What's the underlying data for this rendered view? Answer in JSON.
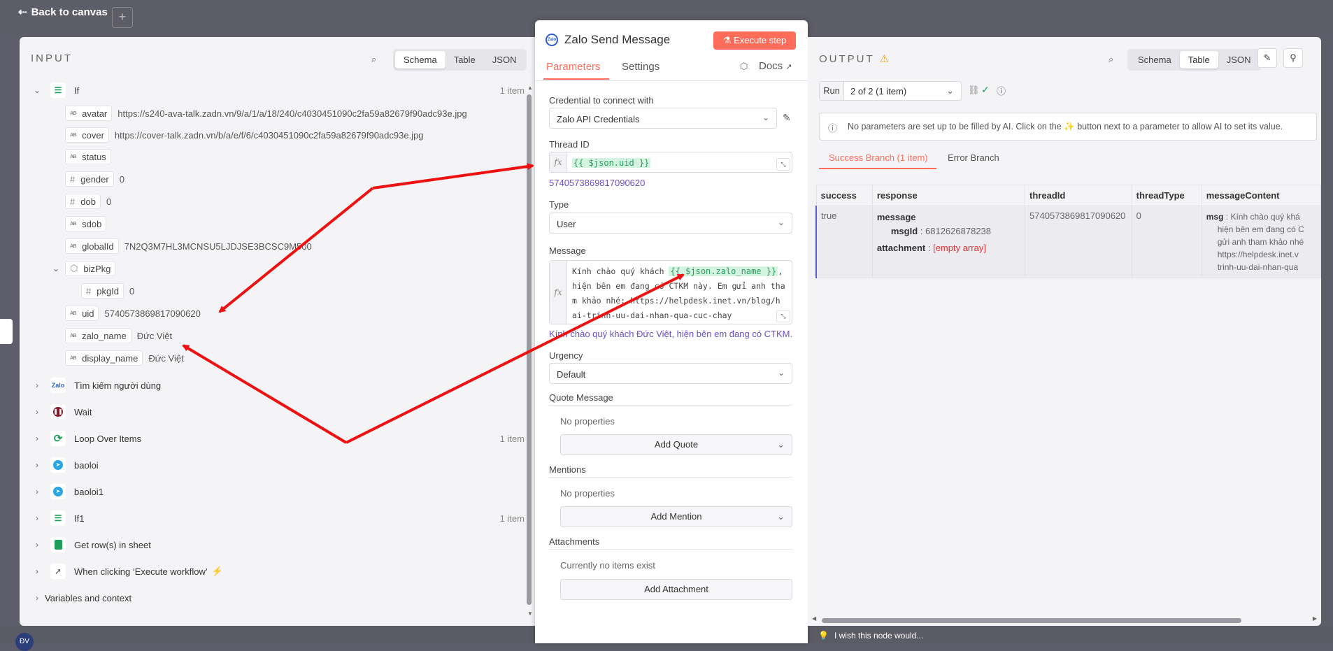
{
  "topbar": {
    "back_label": "Back to canvas",
    "plus": "+"
  },
  "input": {
    "title": "INPUT",
    "view_tabs": [
      "Schema",
      "Table",
      "JSON"
    ],
    "if_node": {
      "name": "If",
      "count": "1 item",
      "fields": [
        {
          "type": "AB",
          "key": "avatar",
          "value": "https://s240-ava-talk.zadn.vn/9/a/1/a/18/240/c4030451090c2fa59a82679f90adc93e.jpg"
        },
        {
          "type": "AB",
          "key": "cover",
          "value": "https://cover-talk.zadn.vn/b/a/e/f/6/c4030451090c2fa59a82679f90adc93e.jpg"
        },
        {
          "type": "AB",
          "key": "status",
          "value": ""
        },
        {
          "type": "#",
          "key": "gender",
          "value": "0"
        },
        {
          "type": "#",
          "key": "dob",
          "value": "0"
        },
        {
          "type": "AB",
          "key": "sdob",
          "value": ""
        },
        {
          "type": "AB",
          "key": "globalId",
          "value": "7N2Q3M7HL3MCNSU5LJDJSE3BCSC9M500"
        }
      ],
      "bizpkg": {
        "key": "bizPkg",
        "child": {
          "type": "#",
          "key": "pkgId",
          "value": "0"
        }
      },
      "tail_fields": [
        {
          "type": "AB",
          "key": "uid",
          "value": "5740573869817090620"
        },
        {
          "type": "AB",
          "key": "zalo_name",
          "value": "Đức Việt"
        },
        {
          "type": "AB",
          "key": "display_name",
          "value": "Đức Việt"
        }
      ]
    },
    "nodes": [
      {
        "name": "Tìm kiếm người dùng",
        "count": "",
        "color": "#2f5fd0",
        "icon": "zalo-icon"
      },
      {
        "name": "Wait",
        "count": "",
        "color": "#8b1a2b",
        "icon": "pause-icon"
      },
      {
        "name": "Loop Over Items",
        "count": "1 item",
        "color": "#1f9e5a",
        "icon": "loop-icon"
      },
      {
        "name": "baoloi",
        "count": "",
        "color": "#2aa6e0",
        "icon": "telegram-icon"
      },
      {
        "name": "baoloi1",
        "count": "",
        "color": "#2aa6e0",
        "icon": "telegram-icon"
      },
      {
        "name": "If1",
        "count": "1 item",
        "color": "#1f9e5a",
        "icon": "if-icon"
      },
      {
        "name": "Get row(s) in sheet",
        "count": "",
        "color": "#1f9e5a",
        "icon": "sheets-icon"
      },
      {
        "name": "When clicking ‘Execute workflow’",
        "count": "",
        "color": "#666666",
        "icon": "cursor-icon"
      }
    ],
    "vars_label": "Variables and context"
  },
  "node_panel": {
    "title": "Zalo Send Message",
    "execute_label": "Execute step",
    "tabs": [
      "Parameters",
      "Settings"
    ],
    "docs_label": "Docs",
    "credential_label": "Credential to connect with",
    "credential_value": "Zalo API Credentials",
    "thread_label": "Thread ID",
    "thread_expr": "{{ $json.uid }}",
    "thread_resolved": "5740573869817090620",
    "type_label": "Type",
    "type_value": "User",
    "message_label": "Message",
    "message_prefix": "Kính chào quý khách ",
    "message_expr": "{{ $json.zalo_name }}",
    "message_suffix_1": ",",
    "message_line_2": "hiện bên em đang có CTKM này. Em gửi anh tha",
    "message_line_3": "m khảo nhé: https://helpdesk.inet.vn/blog/h",
    "message_line_4": "ai-trinh-uu-dai-nhan-qua-cuc-chay",
    "message_resolved": "Kính chào quý khách Đức Việt, hiện bên em đang có CTKM...",
    "urgency_label": "Urgency",
    "urgency_value": "Default",
    "quote_label": "Quote Message",
    "quote_empty": "No properties",
    "quote_btn": "Add Quote",
    "mentions_label": "Mentions",
    "mentions_empty": "No properties",
    "mentions_btn": "Add Mention",
    "attachments_label": "Attachments",
    "attachments_empty": "Currently no items exist",
    "attachments_btn": "Add Attachment"
  },
  "output": {
    "title": "OUTPUT",
    "view_tabs": [
      "Schema",
      "Table",
      "JSON"
    ],
    "run_label": "Run",
    "run_value": "2 of 2 (1 item)",
    "ai_notice": "No parameters are set up to be filled by AI. Click on the ✨ button next to a parameter to allow AI to set its value.",
    "branches": [
      "Success Branch (1 item)",
      "Error Branch"
    ],
    "columns": [
      "success",
      "response",
      "threadId",
      "threadType",
      "messageContent"
    ],
    "row": {
      "success": "true",
      "response_message_key": "message",
      "msgId_key": "msgId",
      "msgId_value": "6812626878238",
      "attachment_key": "attachment",
      "attachment_value": "[empty array]",
      "threadId": "5740573869817090620",
      "threadType": "0",
      "msg_key": "msg",
      "msg_line_1": "Kính chào quý khá",
      "msg_line_2": "hiện bên em đang có C",
      "msg_line_3": "gửi anh tham khảo nhé",
      "msg_line_4": "https://helpdesk.inet.v",
      "msg_line_5": "trinh-uu-dai-nhan-qua"
    },
    "feedback": "I wish this node would..."
  },
  "colors": {
    "accent": "#ff6d5a",
    "panel_bg": "#f4f4f6",
    "expr_green": "#2a9c5d",
    "resolved_purple": "#6b4fc7",
    "annotation_red": "#ee1111"
  },
  "bottom": {
    "avatar_initials": "ĐV"
  }
}
